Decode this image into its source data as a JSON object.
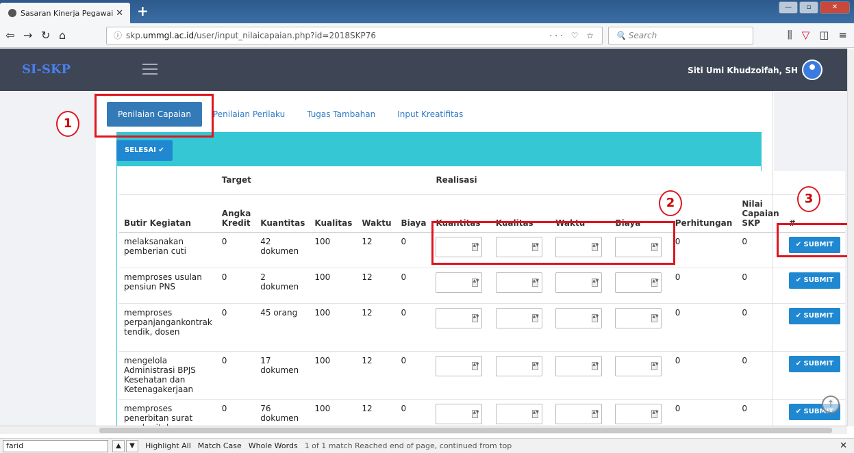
{
  "browser": {
    "tab_title": "Sasaran Kinerja Pegawai",
    "url_prefix": "skp.",
    "url_host": "ummgl.ac.id",
    "url_path": "/user/input_nilaicapaian.php?id=2018SKP76",
    "search_placeholder": "Search",
    "page_actions": "··· ♡ ☆"
  },
  "app": {
    "brand": "SI-SKP",
    "user_name": "Siti Umi Khudzoifah, SH"
  },
  "tabs": [
    {
      "label": "Penilaian Capaian"
    },
    {
      "label": "Penilaian Perilaku"
    },
    {
      "label": "Tugas Tambahan"
    },
    {
      "label": "Input Kreatifitas"
    }
  ],
  "selesai_label": "SELESAI ✔",
  "table": {
    "group_headers": {
      "target": "Target",
      "realisasi": "Realisasi"
    },
    "headers": {
      "butir": "Butir Kegiatan",
      "angka_kredit": "Angka Kredit",
      "kuantitas": "Kuantitas",
      "kualitas": "Kualitas",
      "waktu": "Waktu",
      "biaya": "Biaya",
      "r_kuantitas": "Kuantitas",
      "r_kualitas": "Kualitas",
      "r_waktu": "Waktu",
      "r_biaya": "Biaya",
      "perhitungan": "Perhitungan",
      "nilai": "Nilai Capaian SKP",
      "hash": "#"
    },
    "submit_label": "✔ SUBMIT",
    "rows": [
      {
        "butir": "melaksanakan pemberian cuti",
        "ak": "0",
        "kuantitas": "42 dokumen",
        "kualitas": "100",
        "waktu": "12",
        "biaya": "0",
        "perhitungan": "0",
        "nilai": "0"
      },
      {
        "butir": "memproses usulan pensiun PNS",
        "ak": "0",
        "kuantitas": "2 dokumen",
        "kualitas": "100",
        "waktu": "12",
        "biaya": "0",
        "perhitungan": "0",
        "nilai": "0"
      },
      {
        "butir": "memproses perpanjangankontrak tendik, dosen",
        "ak": "0",
        "kuantitas": "45 orang",
        "kualitas": "100",
        "waktu": "12",
        "biaya": "0",
        "perhitungan": "0",
        "nilai": "0"
      },
      {
        "butir": "mengelola Administrasi BPJS Kesehatan dan Ketenagakerjaan",
        "ak": "0",
        "kuantitas": "17 dokumen",
        "kualitas": "100",
        "waktu": "12",
        "biaya": "0",
        "perhitungan": "0",
        "nilai": "0"
      },
      {
        "butir": "memproses penerbitan surat pemberitahuan",
        "ak": "0",
        "kuantitas": "76 dokumen",
        "kualitas": "100",
        "waktu": "12",
        "biaya": "0",
        "perhitungan": "0",
        "nilai": "0"
      }
    ]
  },
  "annotations": [
    "1",
    "2",
    "3"
  ],
  "findbar": {
    "query": "farid",
    "highlight_all": "Highlight All",
    "match_case": "Match Case",
    "whole_words": "Whole Words",
    "status": "1 of 1 match  Reached end of page, continued from top"
  },
  "colors": {
    "accent": "#337ab7",
    "panel": "#36c7d4",
    "annotation": "#e0141e",
    "header_bg": "#3e4655"
  }
}
